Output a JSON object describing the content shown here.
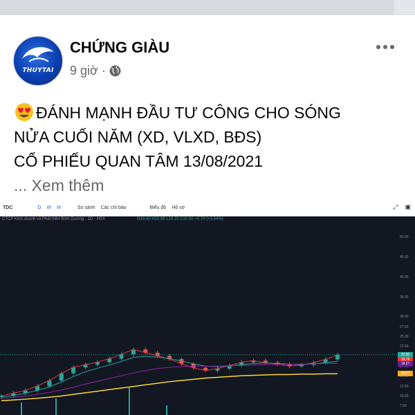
{
  "post": {
    "author": "CHỨNG GIÀU",
    "time": "9 giờ",
    "separator": "·",
    "avatar_text": "THUYTAI",
    "lines": [
      "ĐÁNH MẠNH ĐẦU TƯ CÔNG CHO SÓNG",
      "NỬA CUỐI NĂM (XD, VLXD, BĐS)",
      "CỔ PHIẾU QUAN TÂM 13/08/2021"
    ],
    "see_more": "... Xem thêm"
  },
  "chart_widget": {
    "symbol": "TDC",
    "timeframes": [
      "D",
      "W",
      "M"
    ],
    "compare": "So sánh",
    "indicators": "Các chỉ báo",
    "chart_type": "Biểu đồ",
    "other": "Hồ sơ",
    "subtitle": "CTCP Kinh doanh và Phát triển Bình Dương · 1D · HSX",
    "ohlc": "O19.40 H20.95 L19.20 C20.50 +0.70 (+3.54%)",
    "price_labels": [
      "20.50",
      "18.78",
      "18.27",
      "15.67"
    ],
    "price_label_colors": [
      "#26a69a",
      "#e53935",
      "#6a1b9a",
      "#f9a825"
    ]
  },
  "chart_data": {
    "type": "line",
    "title": "",
    "series": [
      {
        "values": [
          10.1,
          10.8,
          11.5,
          12.6,
          14.0,
          15.8,
          17.3,
          18.0,
          18.6,
          19.5,
          20.6,
          21.8,
          21.0,
          20.2,
          19.4,
          18.2,
          17.2,
          16.5,
          17.0,
          17.8,
          18.6,
          19.0,
          18.5,
          18.1,
          17.6,
          17.9,
          18.5,
          19.3,
          20.5
        ]
      },
      {
        "values": [
          9.8,
          10.2,
          10.8,
          11.5,
          12.4,
          13.6,
          15.0,
          16.2,
          17.1,
          17.9,
          18.8,
          19.8,
          20.1,
          19.9,
          19.5,
          18.9,
          18.2,
          17.6,
          17.5,
          17.7,
          18.0,
          18.3,
          18.4,
          18.3,
          18.1,
          18.0,
          18.2,
          18.5,
          18.8
        ]
      },
      {
        "values": [
          9.5,
          9.8,
          10.1,
          10.5,
          11.0,
          11.6,
          12.3,
          13.1,
          13.8,
          14.5,
          15.2,
          15.9,
          16.5,
          17.0,
          17.3,
          17.5,
          17.6,
          17.6,
          17.6,
          17.7,
          17.8,
          17.9,
          18.0,
          18.0,
          18.1,
          18.1,
          18.2,
          18.3,
          18.3
        ]
      },
      {
        "values": [
          8.9,
          9.1,
          9.3,
          9.5,
          9.8,
          10.1,
          10.5,
          10.9,
          11.3,
          11.7,
          12.1,
          12.5,
          12.9,
          13.3,
          13.7,
          14.0,
          14.3,
          14.6,
          14.8,
          15.0,
          15.2,
          15.3,
          15.4,
          15.5,
          15.5,
          15.6,
          15.6,
          15.7,
          15.7
        ]
      }
    ],
    "xlabel": "",
    "ylabel": "",
    "ylim": [
      6,
      52
    ],
    "yticks": [
      50.0,
      45.0,
      40.0,
      35.0,
      30.0,
      27.5,
      25.0,
      22.5,
      20.0,
      17.5,
      15.0,
      12.5,
      10.0,
      7.5
    ],
    "series_colors": [
      "#e53935",
      "#26a69a",
      "#8e24aa",
      "#fdd835"
    ],
    "grid": false
  }
}
